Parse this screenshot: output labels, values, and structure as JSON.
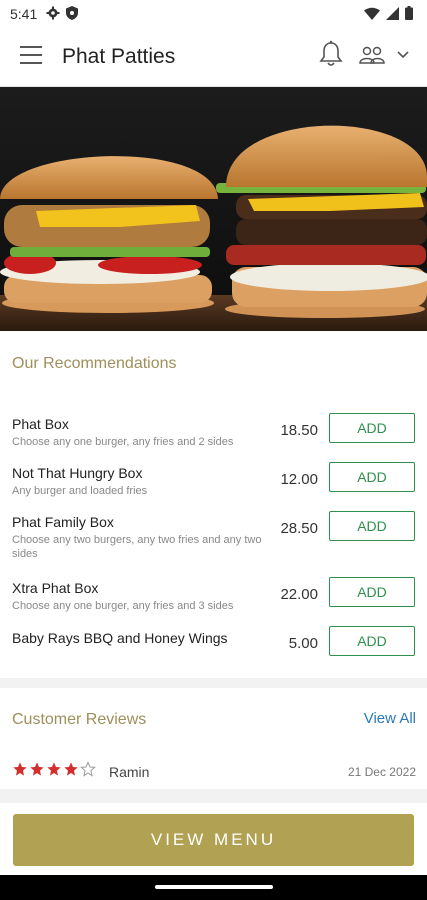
{
  "status_bar": {
    "time": "5:41"
  },
  "app_bar": {
    "title": "Phat Patties"
  },
  "recommendations": {
    "title": "Our Recommendations",
    "items": [
      {
        "name": "Phat Box",
        "description": "Choose any one burger, any fries and 2 sides",
        "price": "18.50",
        "add_label": "ADD"
      },
      {
        "name": "Not That Hungry Box",
        "description": "Any burger and loaded fries",
        "price": "12.00",
        "add_label": "ADD"
      },
      {
        "name": "Phat Family Box",
        "description": "Choose any two burgers, any two fries and any two sides",
        "price": "28.50",
        "add_label": "ADD"
      },
      {
        "name": "Xtra Phat Box",
        "description": "Choose any one burger, any fries and 3 sides",
        "price": "22.00",
        "add_label": "ADD"
      },
      {
        "name": "Baby Rays BBQ and Honey Wings",
        "description": "",
        "price": "5.00",
        "add_label": "ADD"
      }
    ]
  },
  "reviews": {
    "title": "Customer Reviews",
    "view_all_label": "View All",
    "items": [
      {
        "reviewer": "Ramin",
        "rating": 4,
        "max_rating": 5,
        "date": "21 Dec 2022"
      }
    ]
  },
  "footer": {
    "view_menu_label": "VIEW MENU"
  },
  "colors": {
    "accent_gold": "#b1a153",
    "add_green": "#2f8f4e",
    "link_blue": "#2a7ab5",
    "star_red": "#d32f2f"
  }
}
